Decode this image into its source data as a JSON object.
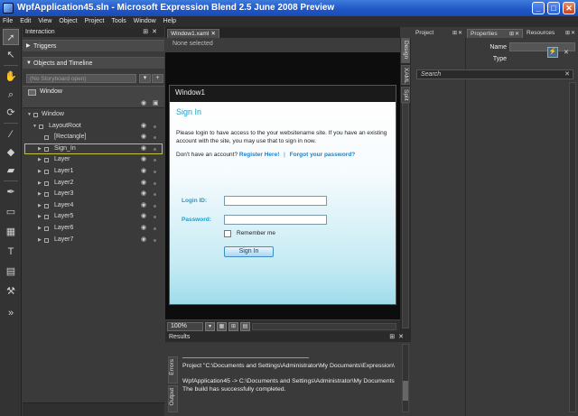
{
  "titlebar": {
    "title": "WpfApplication45.sln - Microsoft Expression Blend 2.5 June 2008 Preview",
    "minimize": "_",
    "maximize": "□",
    "close": "✕"
  },
  "menu": [
    "File",
    "Edit",
    "View",
    "Object",
    "Project",
    "Tools",
    "Window",
    "Help"
  ],
  "interaction": {
    "title": "Interaction",
    "triggers": "Triggers",
    "objects_timeline": "Objects and Timeline",
    "storyboard_placeholder": "(No Storyboard open)",
    "window_label": "Window",
    "tree": [
      {
        "label": "Window",
        "level": 0
      },
      {
        "label": "LayoutRoot",
        "level": 1
      },
      {
        "label": "[Rectangle]",
        "level": 2
      },
      {
        "label": "Sign_In",
        "level": 2,
        "selected": true
      },
      {
        "label": "Layer",
        "level": 2
      },
      {
        "label": "Layer1",
        "level": 2
      },
      {
        "label": "Layer2",
        "level": 2
      },
      {
        "label": "Layer3",
        "level": 2
      },
      {
        "label": "Layer4",
        "level": 2
      },
      {
        "label": "Layer5",
        "level": 2
      },
      {
        "label": "Layer6",
        "level": 2
      },
      {
        "label": "Layer7",
        "level": 2
      }
    ]
  },
  "document": {
    "tab": "Window1.xaml",
    "selection_info": "None selected",
    "window_title": "Window1",
    "zoom": "100%",
    "view_tabs": [
      "Design",
      "XAML",
      "Split"
    ]
  },
  "signin": {
    "title": "Sign In",
    "description": "Please login to have access to the your websitename site. If you have an existing account with the site, you may use that to sign in now.",
    "no_account": "Don't have an account?",
    "register": "Register Here!",
    "separator": "|",
    "forgot": "Forgot your password?",
    "login_label": "Login ID:",
    "password_label": "Password:",
    "remember": "Remember me",
    "button": "Sign In"
  },
  "results": {
    "title": "Results",
    "tabs": [
      "Errors",
      "Output"
    ],
    "lines": [
      "Project \"C:\\Documents and Settings\\Administrator\\My Documents\\Expression\\",
      "WpfApplication45 -> C:\\Documents and Settings\\Administrator\\My Documents",
      "The build has successfully completed."
    ]
  },
  "right": {
    "tabs": [
      "Project",
      "Properties",
      "Resources"
    ],
    "name_label": "Name",
    "type_label": "Type",
    "search_placeholder": "Search"
  }
}
